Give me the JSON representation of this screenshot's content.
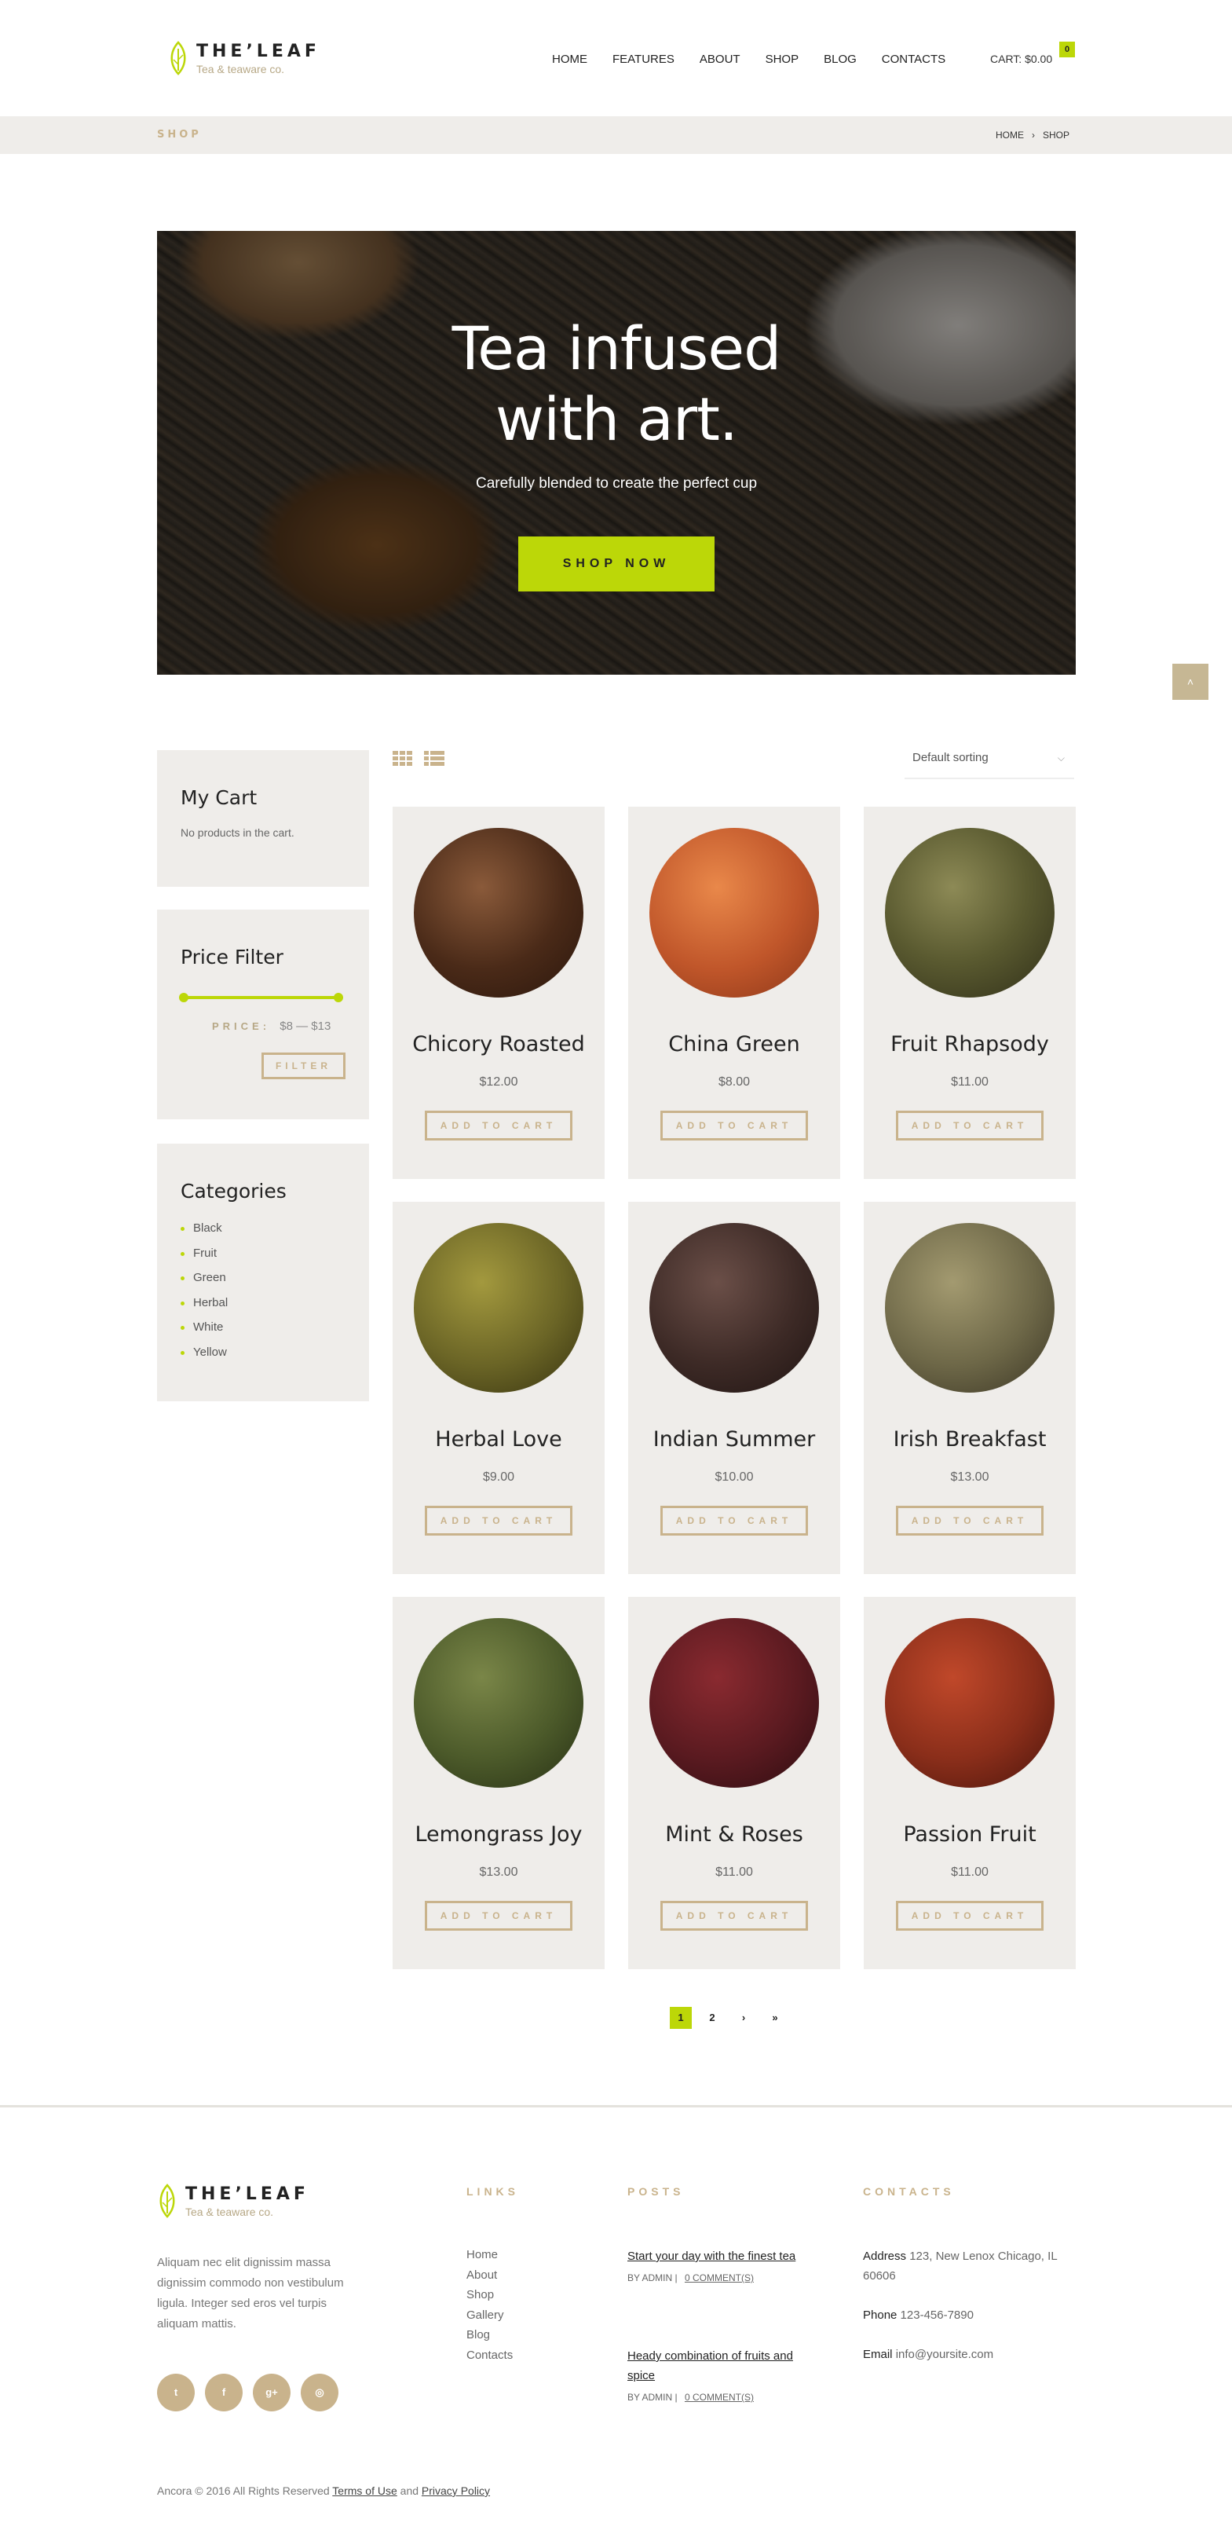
{
  "brand": {
    "name": "THE’LEAF",
    "tagline": "Tea & teaware co."
  },
  "nav": [
    "HOME",
    "FEATURES",
    "ABOUT",
    "SHOP",
    "BLOG",
    "CONTACTS"
  ],
  "cart": {
    "label": "CART: $0.00",
    "count": "0"
  },
  "breadcrumb": {
    "title": "SHOP",
    "home": "HOME",
    "sep": "›",
    "current": "SHOP"
  },
  "hero": {
    "title_line1": "Tea infused",
    "title_line2": "with art.",
    "subtitle": "Carefully blended to create the perfect cup",
    "button": "SHOP NOW"
  },
  "back_to_top": "˄",
  "sidebar": {
    "cart": {
      "title": "My Cart",
      "empty": "No products in the cart."
    },
    "price": {
      "title": "Price Filter",
      "label": "PRICE:",
      "min": "$8",
      "dash": "—",
      "max": "$13",
      "button": "FILTER"
    },
    "categories": {
      "title": "Categories",
      "items": [
        "Black",
        "Fruit",
        "Green",
        "Herbal",
        "White",
        "Yellow"
      ]
    }
  },
  "sorting": {
    "selected": "Default sorting"
  },
  "products": [
    {
      "name": "Chicory Roasted",
      "price": "$12.00",
      "button": "ADD TO CART"
    },
    {
      "name": "China Green",
      "price": "$8.00",
      "button": "ADD TO CART"
    },
    {
      "name": "Fruit Rhapsody",
      "price": "$11.00",
      "button": "ADD TO CART"
    },
    {
      "name": "Herbal Love",
      "price": "$9.00",
      "button": "ADD TO CART"
    },
    {
      "name": "Indian Summer",
      "price": "$10.00",
      "button": "ADD TO CART"
    },
    {
      "name": "Irish Breakfast",
      "price": "$13.00",
      "button": "ADD TO CART"
    },
    {
      "name": "Lemongrass Joy",
      "price": "$13.00",
      "button": "ADD TO CART"
    },
    {
      "name": "Mint & Roses",
      "price": "$11.00",
      "button": "ADD TO CART"
    },
    {
      "name": "Passion Fruit",
      "price": "$11.00",
      "button": "ADD TO CART"
    }
  ],
  "pagination": [
    "1",
    "2",
    "›",
    "»"
  ],
  "footer": {
    "about": "Aliquam nec elit dignissim massa dignissim commodo non vestibulum ligula. Integer sed eros vel turpis aliquam mattis.",
    "socials": [
      "twitter",
      "facebook",
      "google-plus",
      "instagram"
    ],
    "social_glyphs": [
      "t",
      "f",
      "g+",
      "◎"
    ],
    "links_title": "LINKS",
    "links": [
      "Home",
      "About",
      "Shop",
      "Gallery",
      "Blog",
      "Contacts"
    ],
    "posts_title": "POSTS",
    "posts": [
      {
        "title": "Start your day with the finest tea",
        "author": "BY ADMIN",
        "sep": "|",
        "comments": "0 COMMENT(S)"
      },
      {
        "title": "Heady combination of fruits and spice",
        "author": "BY ADMIN",
        "sep": "|",
        "comments": "0 COMMENT(S)"
      }
    ],
    "contacts_title": "CONTACTS",
    "address_label": "Address",
    "address": "123, New Lenox Chicago, IL 60606",
    "phone_label": "Phone",
    "phone": "123-456-7890",
    "email_label": "Email",
    "email": "info@yoursite.com",
    "copyright_prefix": "Ancora © 2016 All Rights Reserved",
    "terms": "Terms of Use",
    "and": "and",
    "privacy": "Privacy Policy"
  },
  "colors": {
    "accent": "#bcd708",
    "gold": "#c9b38c",
    "panel": "#efedea"
  }
}
